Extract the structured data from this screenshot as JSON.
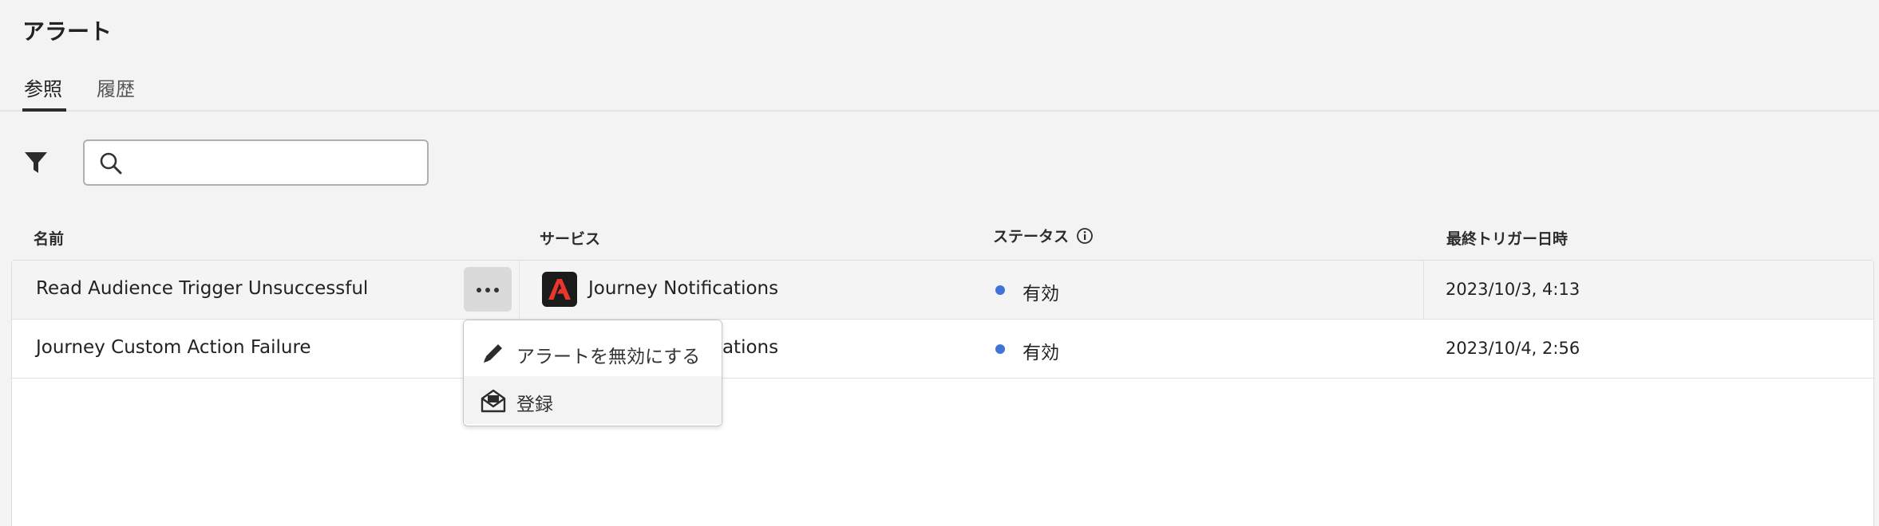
{
  "page": {
    "title": "アラート"
  },
  "tabs": [
    {
      "label": "参照",
      "selected": true
    },
    {
      "label": "履歴",
      "selected": false
    }
  ],
  "search": {
    "value": "",
    "placeholder": ""
  },
  "table": {
    "columns": [
      "名前",
      "サービス",
      "ステータス",
      "最終トリガー日時"
    ],
    "rows": [
      {
        "name": "Read Audience Trigger Unsuccessful",
        "service": "Journey Notifications",
        "status": "有効",
        "last_triggered": "2023/10/3, 4:13"
      },
      {
        "name": "Journey Custom Action Failure",
        "service": "Journey Notifications",
        "status": "有効",
        "last_triggered": "2023/10/4, 2:56"
      }
    ]
  },
  "context_menu": {
    "items": [
      {
        "label": "アラートを無効にする",
        "icon": "pencil-icon"
      },
      {
        "label": "登録",
        "icon": "envelope-icon"
      }
    ]
  },
  "colors": {
    "status_active": "#3f74d6",
    "service_logo_bg": "#1b1b1b",
    "service_logo_fg": "#e9352b"
  },
  "icons": {
    "filter": "filter-icon",
    "search": "search-icon",
    "info": "info-icon",
    "more": "more-icon"
  }
}
